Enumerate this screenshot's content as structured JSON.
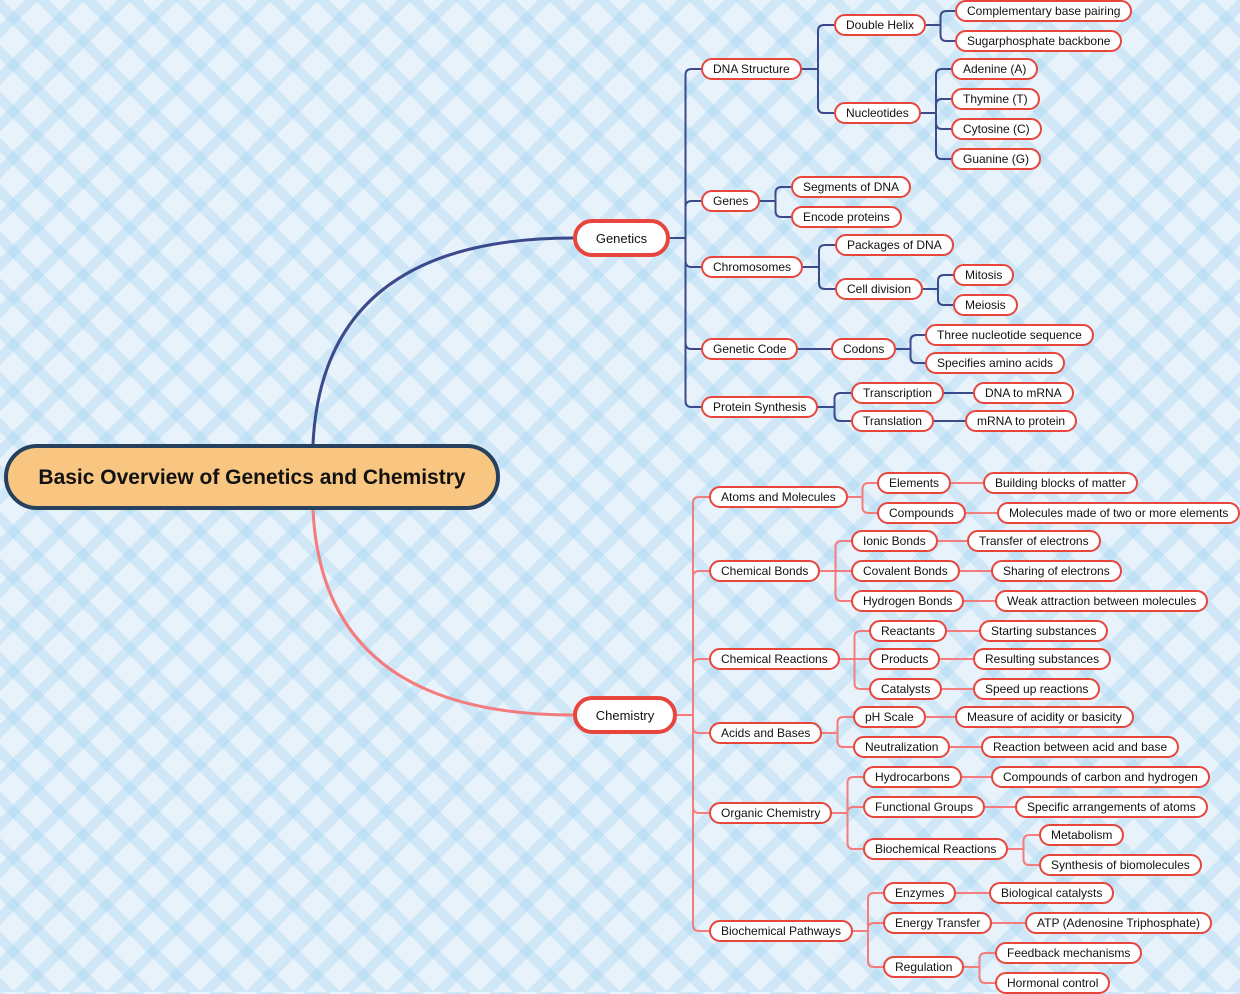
{
  "root": {
    "label": "Basic Overview of Genetics and Chemistry"
  },
  "colors": {
    "genetics_branch": "#3b4a8c",
    "chemistry_branch": "#f47c7c",
    "node_border": "#e8453c",
    "root_fill": "#f8c681",
    "root_border": "#26405e"
  },
  "branches": [
    {
      "label": "Genetics",
      "children": [
        {
          "label": "DNA Structure",
          "children": [
            {
              "label": "Double Helix",
              "children": [
                {
                  "label": "Complementary base pairing"
                },
                {
                  "label": "Sugarphosphate backbone"
                }
              ]
            },
            {
              "label": "Nucleotides",
              "children": [
                {
                  "label": "Adenine (A)"
                },
                {
                  "label": "Thymine (T)"
                },
                {
                  "label": "Cytosine (C)"
                },
                {
                  "label": "Guanine (G)"
                }
              ]
            }
          ]
        },
        {
          "label": "Genes",
          "children": [
            {
              "label": "Segments of DNA"
            },
            {
              "label": "Encode proteins"
            }
          ]
        },
        {
          "label": "Chromosomes",
          "children": [
            {
              "label": "Packages of DNA"
            },
            {
              "label": "Cell division",
              "children": [
                {
                  "label": "Mitosis"
                },
                {
                  "label": "Meiosis"
                }
              ]
            }
          ]
        },
        {
          "label": "Genetic Code",
          "children": [
            {
              "label": "Codons",
              "children": [
                {
                  "label": "Three nucleotide sequence"
                },
                {
                  "label": "Specifies amino acids"
                }
              ]
            }
          ]
        },
        {
          "label": "Protein Synthesis",
          "children": [
            {
              "label": "Transcription",
              "children": [
                {
                  "label": "DNA to mRNA"
                }
              ]
            },
            {
              "label": "Translation",
              "children": [
                {
                  "label": "mRNA to protein"
                }
              ]
            }
          ]
        }
      ]
    },
    {
      "label": "Chemistry",
      "children": [
        {
          "label": "Atoms and Molecules",
          "children": [
            {
              "label": "Elements",
              "children": [
                {
                  "label": "Building blocks of matter"
                }
              ]
            },
            {
              "label": "Compounds",
              "children": [
                {
                  "label": "Molecules made of two or more elements"
                }
              ]
            }
          ]
        },
        {
          "label": "Chemical Bonds",
          "children": [
            {
              "label": "Ionic Bonds",
              "children": [
                {
                  "label": "Transfer of electrons"
                }
              ]
            },
            {
              "label": "Covalent Bonds",
              "children": [
                {
                  "label": "Sharing of electrons"
                }
              ]
            },
            {
              "label": "Hydrogen Bonds",
              "children": [
                {
                  "label": "Weak attraction between molecules"
                }
              ]
            }
          ]
        },
        {
          "label": "Chemical Reactions",
          "children": [
            {
              "label": "Reactants",
              "children": [
                {
                  "label": "Starting substances"
                }
              ]
            },
            {
              "label": "Products",
              "children": [
                {
                  "label": "Resulting substances"
                }
              ]
            },
            {
              "label": "Catalysts",
              "children": [
                {
                  "label": "Speed up reactions"
                }
              ]
            }
          ]
        },
        {
          "label": "Acids and Bases",
          "children": [
            {
              "label": "pH Scale",
              "children": [
                {
                  "label": "Measure of acidity or basicity"
                }
              ]
            },
            {
              "label": "Neutralization",
              "children": [
                {
                  "label": "Reaction between acid and base"
                }
              ]
            }
          ]
        },
        {
          "label": "Organic Chemistry",
          "children": [
            {
              "label": "Hydrocarbons",
              "children": [
                {
                  "label": "Compounds of carbon and hydrogen"
                }
              ]
            },
            {
              "label": "Functional Groups",
              "children": [
                {
                  "label": "Specific arrangements of atoms"
                }
              ]
            },
            {
              "label": "Biochemical Reactions",
              "children": [
                {
                  "label": "Metabolism"
                },
                {
                  "label": "Synthesis of biomolecules"
                }
              ]
            }
          ]
        },
        {
          "label": "Biochemical Pathways",
          "children": [
            {
              "label": "Enzymes",
              "children": [
                {
                  "label": "Biological catalysts"
                }
              ]
            },
            {
              "label": "Energy Transfer",
              "children": [
                {
                  "label": "ATP (Adenosine Triphosphate)"
                }
              ]
            },
            {
              "label": "Regulation",
              "children": [
                {
                  "label": "Feedback mechanisms"
                },
                {
                  "label": "Hormonal control"
                }
              ]
            }
          ]
        }
      ]
    }
  ]
}
